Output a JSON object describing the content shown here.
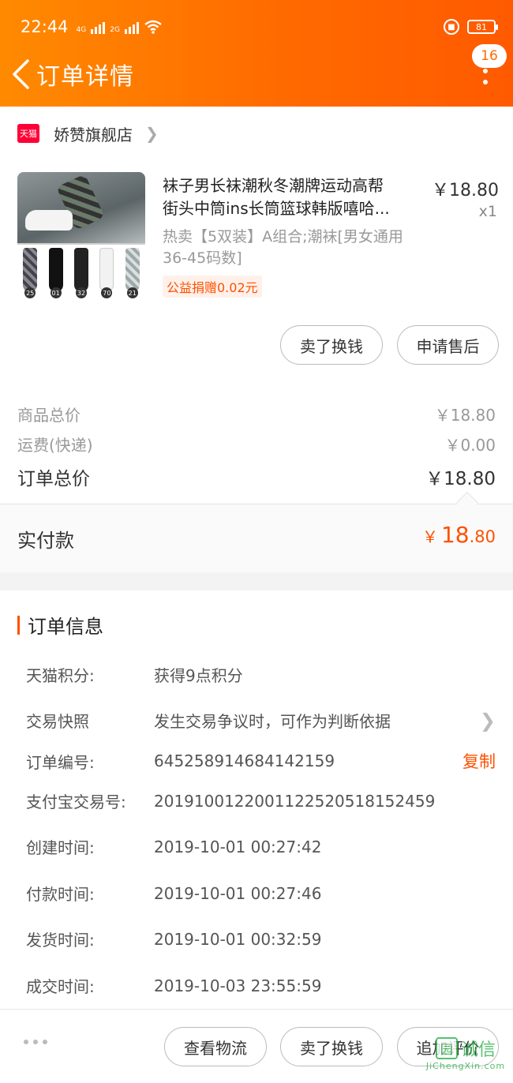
{
  "status": {
    "time": "22:44",
    "net1": "4G",
    "net2": "2G",
    "battery": "81"
  },
  "header": {
    "title": "订单详情",
    "badge": "16"
  },
  "shop": {
    "brand_icon": "天猫",
    "name": "娇赞旗舰店"
  },
  "product": {
    "name_line1": "袜子男长袜潮秋冬潮牌运动高帮",
    "name_line2": "街头中筒ins长筒篮球韩版嘻哈...",
    "price": "￥18.80",
    "qty": "x1",
    "sku": "热卖【5双装】A组合;潮袜[男女通用36-45码数]",
    "charity": "公益捐赠0.02元",
    "sock_numbers": [
      "25",
      "01",
      "32",
      "70",
      "21"
    ]
  },
  "item_actions": {
    "sell": "卖了换钱",
    "after_sale": "申请售后"
  },
  "summary": {
    "goods_label": "商品总价",
    "goods_value": "￥18.80",
    "shipping_label": "运费(快递)",
    "shipping_value": "￥0.00",
    "total_label": "订单总价",
    "total_value": "￥18.80",
    "paid_label": "实付款",
    "paid_currency": "￥",
    "paid_int": "18",
    "paid_dec": ".80"
  },
  "order_info": {
    "title": "订单信息",
    "rows": [
      {
        "k": "天猫积分:",
        "v": "获得9点积分"
      },
      {
        "k": "交易快照",
        "v": "发生交易争议时，可作为判断依据"
      },
      {
        "k": "订单编号:",
        "v": "645258914684142159"
      },
      {
        "k": "支付宝交易号:",
        "v": "2019100122001122520518152459"
      },
      {
        "k": "创建时间:",
        "v": "2019-10-01 00:27:42"
      },
      {
        "k": "付款时间:",
        "v": "2019-10-01 00:27:46"
      },
      {
        "k": "发货时间:",
        "v": "2019-10-01 00:32:59"
      },
      {
        "k": "成交时间:",
        "v": "2019-10-03 23:55:59"
      }
    ],
    "copy_label": "复制"
  },
  "bottom_bar": {
    "logistics": "查看物流",
    "sell": "卖了换钱",
    "review": "追加评价"
  },
  "watermark": {
    "text": "诚信",
    "url": "JiChengXin.com",
    "icon": "园"
  },
  "colors": {
    "accent": "#ff5000",
    "header": "#ff6a00"
  }
}
